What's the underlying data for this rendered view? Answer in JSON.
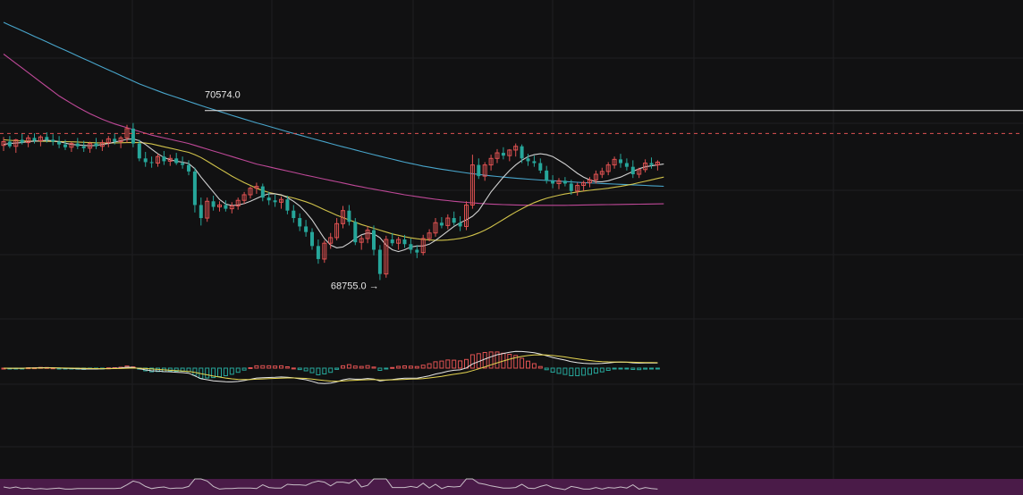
{
  "chart_data": {
    "type": "candlestick",
    "colors": {
      "background": "#111112",
      "grid": "#1e1e21",
      "up": "#e05252",
      "down": "#26a69a",
      "ma_fast": "#e6e6e6",
      "ma_mid": "#e6d651",
      "ma_slow": "#4fb6e0",
      "ma_slower": "#d24fa6",
      "price_line": "#e6e6e6",
      "last_price_line": "#e05252",
      "macd_line": "#e6e6e6",
      "signal_line": "#e6d651",
      "vol_band": "#4a1b48"
    },
    "annotations": {
      "high_label": "70574.0",
      "low_label": "68755.0 →"
    },
    "high_value": 70574,
    "low_value": 68755,
    "last_price": 70328,
    "price_axis": {
      "min": 68500,
      "max": 71760
    },
    "ohlc": [
      [
        70200,
        70290,
        70140,
        70240
      ],
      [
        70240,
        70300,
        70170,
        70190
      ],
      [
        70190,
        70270,
        70120,
        70260
      ],
      [
        70260,
        70330,
        70210,
        70230
      ],
      [
        70230,
        70310,
        70180,
        70280
      ],
      [
        70280,
        70330,
        70220,
        70250
      ],
      [
        70250,
        70310,
        70190,
        70290
      ],
      [
        70290,
        70340,
        70230,
        70260
      ],
      [
        70260,
        70320,
        70200,
        70240
      ],
      [
        70240,
        70300,
        70170,
        70210
      ],
      [
        70210,
        70260,
        70150,
        70180
      ],
      [
        70180,
        70240,
        70130,
        70220
      ],
      [
        70220,
        70280,
        70160,
        70190
      ],
      [
        70190,
        70250,
        70130,
        70170
      ],
      [
        70170,
        70240,
        70120,
        70220
      ],
      [
        70220,
        70280,
        70160,
        70190
      ],
      [
        70190,
        70260,
        70140,
        70230
      ],
      [
        70230,
        70300,
        70180,
        70270
      ],
      [
        70270,
        70330,
        70210,
        70240
      ],
      [
        70240,
        70300,
        70170,
        70280
      ],
      [
        70280,
        70420,
        70230,
        70380
      ],
      [
        70380,
        70440,
        70180,
        70220
      ],
      [
        70220,
        70260,
        70030,
        70060
      ],
      [
        70060,
        70130,
        69970,
        70020
      ],
      [
        70020,
        70080,
        69960,
        70010
      ],
      [
        70010,
        70110,
        69970,
        70080
      ],
      [
        70080,
        70140,
        69990,
        70030
      ],
      [
        70030,
        70100,
        69980,
        70060
      ],
      [
        70060,
        70120,
        69990,
        70010
      ],
      [
        70010,
        70080,
        69950,
        69990
      ],
      [
        69990,
        70040,
        69880,
        69920
      ],
      [
        69920,
        69960,
        69480,
        69560
      ],
      [
        69560,
        69640,
        69340,
        69420
      ],
      [
        69420,
        69640,
        69380,
        69600
      ],
      [
        69600,
        69660,
        69500,
        69540
      ],
      [
        69540,
        69600,
        69490,
        69560
      ],
      [
        69560,
        69610,
        69490,
        69520
      ],
      [
        69520,
        69590,
        69470,
        69550
      ],
      [
        69550,
        69640,
        69510,
        69610
      ],
      [
        69610,
        69700,
        69570,
        69670
      ],
      [
        69670,
        69760,
        69630,
        69740
      ],
      [
        69740,
        69800,
        69680,
        69760
      ],
      [
        69760,
        69790,
        69600,
        69640
      ],
      [
        69640,
        69700,
        69560,
        69610
      ],
      [
        69610,
        69670,
        69540,
        69590
      ],
      [
        69590,
        69650,
        69520,
        69620
      ],
      [
        69620,
        69660,
        69460,
        69500
      ],
      [
        69500,
        69560,
        69370,
        69420
      ],
      [
        69420,
        69470,
        69280,
        69330
      ],
      [
        69330,
        69400,
        69220,
        69270
      ],
      [
        69270,
        69310,
        69080,
        69120
      ],
      [
        69120,
        69190,
        68930,
        68980
      ],
      [
        68980,
        69180,
        68940,
        69150
      ],
      [
        69150,
        69260,
        69090,
        69210
      ],
      [
        69210,
        69420,
        69180,
        69360
      ],
      [
        69360,
        69550,
        69310,
        69500
      ],
      [
        69500,
        69560,
        69340,
        69380
      ],
      [
        69380,
        69420,
        69130,
        69160
      ],
      [
        69160,
        69230,
        69080,
        69200
      ],
      [
        69200,
        69330,
        69150,
        69290
      ],
      [
        69290,
        69340,
        69020,
        69080
      ],
      [
        69080,
        69130,
        68755,
        68820
      ],
      [
        68820,
        69230,
        68780,
        69190
      ],
      [
        69190,
        69260,
        69120,
        69150
      ],
      [
        69150,
        69220,
        69080,
        69190
      ],
      [
        69190,
        69240,
        69100,
        69140
      ],
      [
        69140,
        69200,
        69040,
        69080
      ],
      [
        69080,
        69130,
        68990,
        69050
      ],
      [
        69050,
        69240,
        69020,
        69200
      ],
      [
        69200,
        69300,
        69170,
        69260
      ],
      [
        69260,
        69420,
        69220,
        69370
      ],
      [
        69370,
        69430,
        69310,
        69340
      ],
      [
        69340,
        69460,
        69300,
        69420
      ],
      [
        69420,
        69490,
        69340,
        69370
      ],
      [
        69370,
        69440,
        69280,
        69330
      ],
      [
        69330,
        69600,
        69290,
        69560
      ],
      [
        69560,
        70100,
        69520,
        69990
      ],
      [
        69990,
        70060,
        69840,
        69870
      ],
      [
        69870,
        70020,
        69820,
        69990
      ],
      [
        69990,
        70100,
        69930,
        70060
      ],
      [
        70060,
        70160,
        70010,
        70120
      ],
      [
        70120,
        70180,
        70050,
        70090
      ],
      [
        70090,
        70160,
        70030,
        70150
      ],
      [
        70150,
        70220,
        70080,
        70190
      ],
      [
        70190,
        70210,
        70010,
        70060
      ],
      [
        70060,
        70110,
        69980,
        70030
      ],
      [
        70030,
        70090,
        69970,
        70010
      ],
      [
        70010,
        70060,
        69900,
        69930
      ],
      [
        69930,
        69980,
        69790,
        69820
      ],
      [
        69820,
        69880,
        69740,
        69790
      ],
      [
        69790,
        69850,
        69730,
        69820
      ],
      [
        69820,
        69860,
        69760,
        69790
      ],
      [
        69790,
        69830,
        69670,
        69710
      ],
      [
        69710,
        69800,
        69660,
        69770
      ],
      [
        69770,
        69820,
        69710,
        69800
      ],
      [
        69800,
        69860,
        69750,
        69830
      ],
      [
        69830,
        69930,
        69790,
        69890
      ],
      [
        69890,
        69960,
        69850,
        69920
      ],
      [
        69920,
        70020,
        69880,
        69990
      ],
      [
        69990,
        70080,
        69950,
        70050
      ],
      [
        70050,
        70110,
        69960,
        70010
      ],
      [
        70010,
        70060,
        69930,
        69970
      ],
      [
        69970,
        70040,
        69850,
        69890
      ],
      [
        69890,
        69960,
        69850,
        69940
      ],
      [
        69940,
        70050,
        69910,
        70010
      ],
      [
        70010,
        70070,
        69950,
        69990
      ],
      [
        69990,
        70040,
        69930,
        70020
      ]
    ],
    "ma_fast": [
      70210,
      70220,
      70225,
      70230,
      70240,
      70245,
      70250,
      70255,
      70250,
      70240,
      70225,
      70210,
      70205,
      70200,
      70195,
      70200,
      70210,
      70220,
      70235,
      70250,
      70265,
      70270,
      70250,
      70210,
      70160,
      70110,
      70070,
      70045,
      70030,
      70020,
      70005,
      69950,
      69860,
      69780,
      69700,
      69620,
      69570,
      69555,
      69560,
      69575,
      69600,
      69630,
      69660,
      69680,
      69680,
      69670,
      69640,
      69600,
      69550,
      69480,
      69400,
      69300,
      69200,
      69130,
      69100,
      69110,
      69150,
      69200,
      69240,
      69260,
      69250,
      69210,
      69130,
      69080,
      69060,
      69080,
      69110,
      69120,
      69120,
      69140,
      69180,
      69230,
      69280,
      69330,
      69370,
      69400,
      69440,
      69500,
      69600,
      69700,
      69780,
      69860,
      69930,
      69990,
      70040,
      70080,
      70100,
      70110,
      70100,
      70080,
      70040,
      70000,
      69950,
      69900,
      69860,
      69830,
      69810,
      69810,
      69820,
      69840,
      69860,
      69890,
      69920,
      69950,
      69970,
      69980,
      69990,
      70000
    ],
    "ma_mid": [
      70260,
      70255,
      70250,
      70248,
      70246,
      70245,
      70244,
      70243,
      70242,
      70241,
      70240,
      70238,
      70236,
      70233,
      70230,
      70228,
      70226,
      70225,
      70226,
      70228,
      70230,
      70232,
      70230,
      70225,
      70215,
      70200,
      70185,
      70170,
      70155,
      70140,
      70125,
      70100,
      70070,
      70030,
      69990,
      69950,
      69910,
      69870,
      69835,
      69800,
      69770,
      69740,
      69715,
      69695,
      69680,
      69665,
      69650,
      69635,
      69615,
      69595,
      69570,
      69540,
      69510,
      69480,
      69450,
      69425,
      69400,
      69375,
      69350,
      69330,
      69310,
      69290,
      69270,
      69250,
      69235,
      69220,
      69208,
      69198,
      69190,
      69185,
      69182,
      69182,
      69185,
      69192,
      69202,
      69215,
      69235,
      69260,
      69290,
      69325,
      69365,
      69405,
      69445,
      69485,
      69520,
      69555,
      69585,
      69610,
      69632,
      69650,
      69665,
      69678,
      69690,
      69700,
      69710,
      69718,
      69725,
      69732,
      69740,
      69750,
      69760,
      69772,
      69785,
      69800,
      69815,
      69830,
      69845,
      69860
    ],
    "ma_slow": [
      71520,
      71490,
      71460,
      71430,
      71400,
      71370,
      71340,
      71310,
      71280,
      71250,
      71220,
      71190,
      71160,
      71130,
      71100,
      71070,
      71040,
      71010,
      70980,
      70950,
      70920,
      70890,
      70860,
      70835,
      70810,
      70785,
      70760,
      70738,
      70716,
      70694,
      70672,
      70650,
      70628,
      70606,
      70585,
      70564,
      70543,
      70522,
      70502,
      70482,
      70462,
      70442,
      70423,
      70404,
      70385,
      70366,
      70347,
      70328,
      70310,
      70292,
      70274,
      70256,
      70238,
      70220,
      70202,
      70185,
      70168,
      70151,
      70134,
      70117,
      70100,
      70084,
      70068,
      70052,
      70036,
      70020,
      70006,
      69992,
      69978,
      69966,
      69955,
      69944,
      69934,
      69924,
      69914,
      69905,
      69896,
      69888,
      69880,
      69873,
      69866,
      69860,
      69854,
      69848,
      69843,
      69838,
      69833,
      69828,
      69824,
      69820,
      69816,
      69812,
      69808,
      69804,
      69800,
      69797,
      69794,
      69791,
      69788,
      69785,
      69782,
      69779,
      69776,
      69773,
      69770,
      69767,
      69764,
      69761
    ],
    "ma_slower": [
      71180,
      71130,
      71080,
      71030,
      70980,
      70930,
      70880,
      70830,
      70780,
      70730,
      70690,
      70650,
      70610,
      70575,
      70540,
      70510,
      70480,
      70455,
      70430,
      70410,
      70390,
      70370,
      70350,
      70330,
      70310,
      70295,
      70280,
      70265,
      70250,
      70235,
      70220,
      70200,
      70180,
      70160,
      70140,
      70120,
      70100,
      70080,
      70060,
      70040,
      70020,
      70000,
      69985,
      69970,
      69955,
      69940,
      69925,
      69910,
      69895,
      69880,
      69866,
      69852,
      69838,
      69824,
      69810,
      69796,
      69782,
      69768,
      69755,
      69742,
      69730,
      69718,
      69706,
      69694,
      69682,
      69670,
      69660,
      69650,
      69640,
      69630,
      69622,
      69614,
      69607,
      69600,
      69594,
      69588,
      69583,
      69578,
      69574,
      69570,
      69567,
      69564,
      69562,
      69560,
      69559,
      69558,
      69557,
      69557,
      69557,
      69557,
      69557,
      69557,
      69558,
      69559,
      69560,
      69561,
      69562,
      69563,
      69564,
      69565,
      69566,
      69567,
      69568,
      69569,
      69570,
      69571,
      69572,
      69573
    ]
  }
}
